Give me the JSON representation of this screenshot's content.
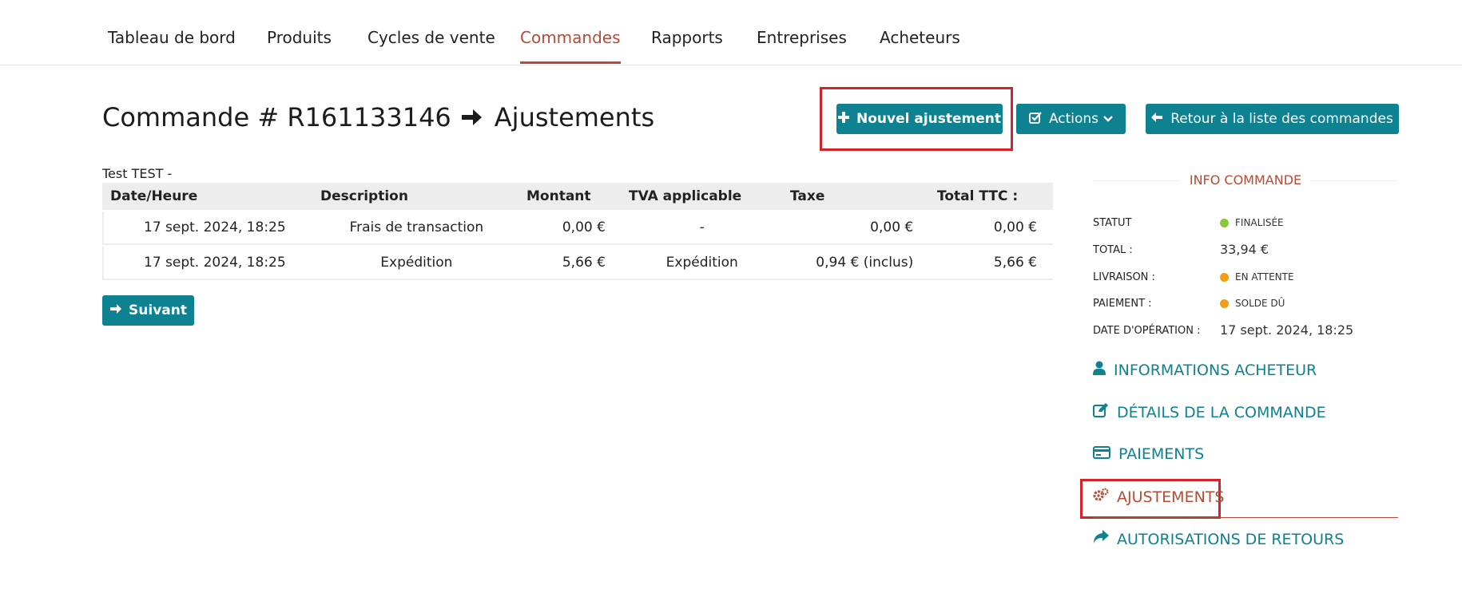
{
  "nav": {
    "items": [
      {
        "label": "Tableau de bord"
      },
      {
        "label": "Produits"
      },
      {
        "label": "Cycles de vente"
      },
      {
        "label": "Commandes"
      },
      {
        "label": "Rapports"
      },
      {
        "label": "Entreprises"
      },
      {
        "label": "Acheteurs"
      }
    ],
    "active": "Commandes"
  },
  "page": {
    "title_order": "Commande # R161133146",
    "title_section": "Ajustements"
  },
  "buttons": {
    "new_adjustment": "Nouvel ajustement",
    "actions": "Actions",
    "back_to_list": "Retour à la liste des commandes",
    "next": "Suivant"
  },
  "customer": "Test TEST -",
  "table": {
    "headers": [
      "Date/Heure",
      "Description",
      "Montant",
      "TVA applicable",
      "Taxe",
      "Total TTC :"
    ],
    "rows": [
      [
        "17 sept. 2024, 18:25",
        "Frais de transaction",
        "0,00 €",
        "-",
        "0,00 €",
        "0,00 €"
      ],
      [
        "17 sept. 2024, 18:25",
        "Expédition",
        "5,66 €",
        "Expédition",
        "0,94 € (inclus)",
        "5,66 €"
      ]
    ]
  },
  "info": {
    "title": "INFO COMMANDE",
    "status_label": "STATUT",
    "status_value": "FINALISÉE",
    "total_label": "TOTAL :",
    "total_value": "33,94 €",
    "delivery_label": "LIVRAISON :",
    "delivery_value": "EN ATTENTE",
    "payment_label": "PAIEMENT :",
    "payment_value": "SOLDE DÛ",
    "date_label": "DATE D'OPÉRATION :",
    "date_value": "17 sept. 2024, 18:25"
  },
  "side_links": [
    {
      "label": "INFORMATIONS ACHETEUR",
      "icon": "user-icon"
    },
    {
      "label": "DÉTAILS DE LA COMMANDE",
      "icon": "edit-icon"
    },
    {
      "label": "PAIEMENTS",
      "icon": "credit-card-icon"
    },
    {
      "label": "AJUSTEMENTS",
      "icon": "gears-icon"
    },
    {
      "label": "AUTORISATIONS DE RETOURS",
      "icon": "share-icon"
    }
  ],
  "colors": {
    "accent": "#0e8290",
    "active": "#b84a32",
    "status_green": "#8cc63f",
    "status_orange": "#f39c12",
    "highlight": "#d4232a"
  }
}
